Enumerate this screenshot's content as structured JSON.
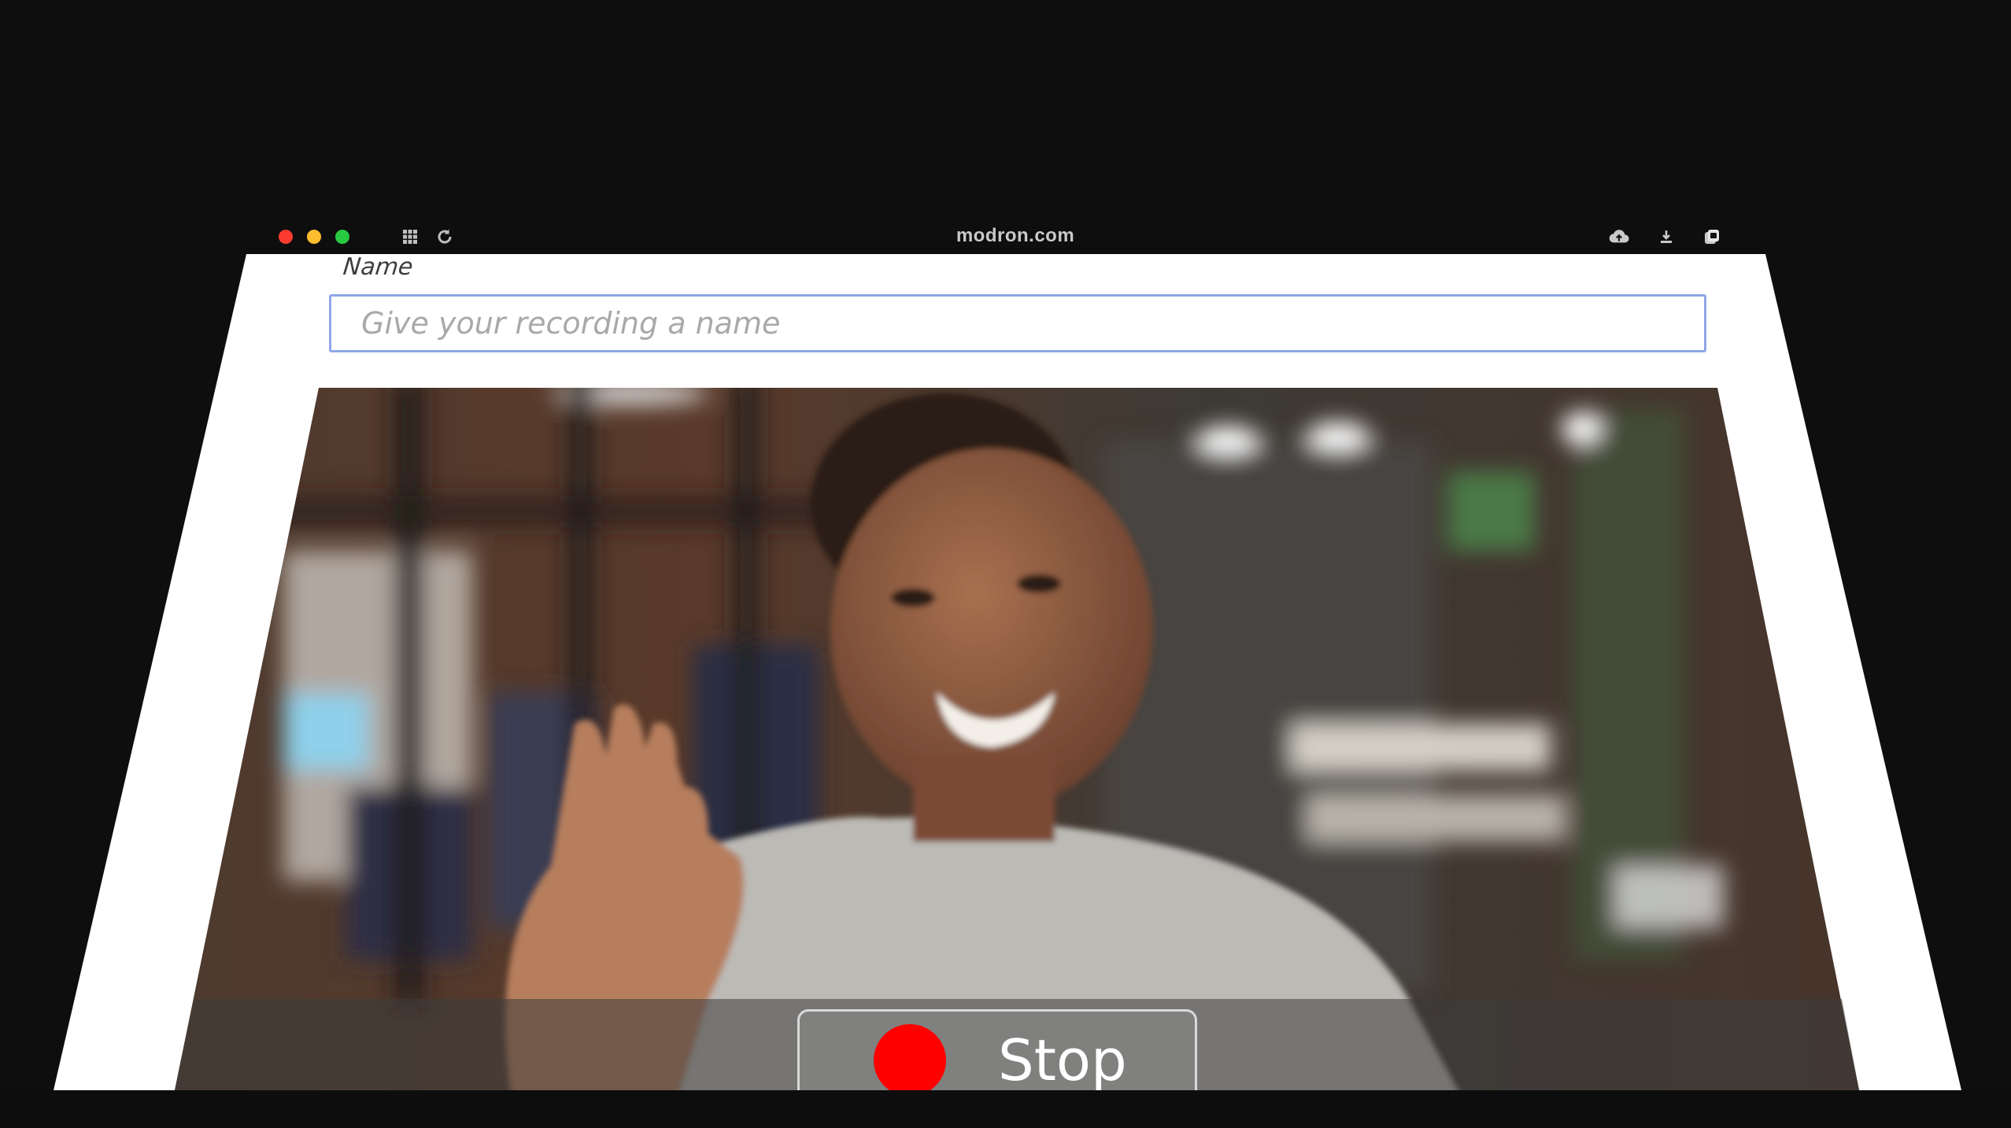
{
  "browser": {
    "url": "modron.com",
    "traffic_colors": {
      "close": "#ff3b30",
      "minimize": "#ffbd2e",
      "maximize": "#28c940"
    },
    "left_icons": [
      "grid-icon",
      "reload-icon"
    ],
    "right_icons": [
      "cloud-upload-icon",
      "download-icon",
      "copy-icon"
    ]
  },
  "form": {
    "name_label": "Name",
    "name_placeholder": "Give your recording a name",
    "name_value": "",
    "input_border_color": "#8ea8e6"
  },
  "recorder": {
    "stop_label": "Stop",
    "record_indicator_color": "#ff0000"
  }
}
